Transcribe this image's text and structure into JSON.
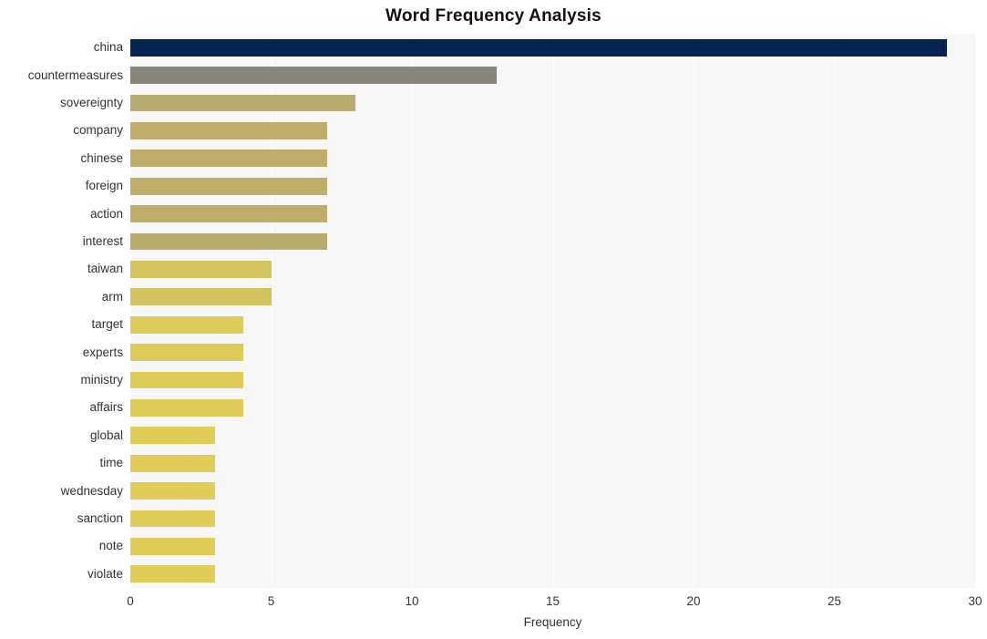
{
  "chart_data": {
    "type": "bar",
    "orientation": "horizontal",
    "title": "Word Frequency Analysis",
    "xlabel": "Frequency",
    "ylabel": "",
    "xlim": [
      0,
      30
    ],
    "ylim": null,
    "xticks": [
      "0",
      "5",
      "10",
      "15",
      "20",
      "25",
      "30"
    ],
    "xtick_values": [
      0,
      5,
      10,
      15,
      20,
      25,
      30
    ],
    "grid": true,
    "grid_axis": "x",
    "legend": false,
    "categories": [
      "china",
      "countermeasures",
      "sovereignty",
      "company",
      "chinese",
      "foreign",
      "action",
      "interest",
      "taiwan",
      "arm",
      "target",
      "experts",
      "ministry",
      "affairs",
      "global",
      "time",
      "wednesday",
      "sanction",
      "note",
      "violate"
    ],
    "values": [
      29,
      13,
      8,
      7,
      7,
      7,
      7,
      7,
      5,
      5,
      4,
      4,
      4,
      4,
      3,
      3,
      3,
      3,
      3,
      3
    ],
    "bar_colors": [
      "#05244f",
      "#87847a",
      "#b8ab6e",
      "#bfae6a",
      "#bfae6a",
      "#bfae6a",
      "#bfae6a",
      "#b8ab6e",
      "#d4c45d",
      "#d2c35f",
      "#ddcb57",
      "#ddcb57",
      "#ddcb57",
      "#ddcb57",
      "#e0cd57",
      "#e0cd57",
      "#e0cd57",
      "#e0cd57",
      "#e0cd57",
      "#e0cd57"
    ],
    "plot_background": "#f7f7f7",
    "grid_color": "#ffffff",
    "figure_background": "#ffffff",
    "text_color": "#333333",
    "title_color": "#111111"
  }
}
